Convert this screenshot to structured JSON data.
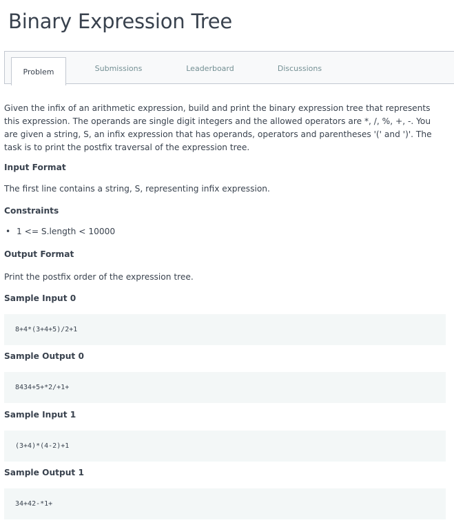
{
  "page": {
    "title": "Binary Expression Tree"
  },
  "tabs": [
    {
      "label": "Problem",
      "active": true
    },
    {
      "label": "Submissions",
      "active": false
    },
    {
      "label": "Leaderboard",
      "active": false
    },
    {
      "label": "Discussions",
      "active": false
    }
  ],
  "problem": {
    "description": "Given the infix of an arithmetic expression, build and print the binary expression tree that represents this expression. The operands are single digit integers and the allowed operators are *, /, %, +, -. You are given a string, S, an infix expression that has operands, operators and parentheses '(' and ')'. The task is to print the postfix traversal of the expression tree.",
    "input_format_heading": "Input Format",
    "input_format_text": "The first line contains a string, S, representing infix expression.",
    "constraints_heading": "Constraints",
    "constraints": [
      "1 <= S.length < 10000"
    ],
    "output_format_heading": "Output Format",
    "output_format_text": "Print the postfix order of the expression tree.",
    "samples": [
      {
        "heading": "Sample Input 0",
        "code": "8+4*(3+4+5)/2+1"
      },
      {
        "heading": "Sample Output 0",
        "code": "8434+5+*2/+1+"
      },
      {
        "heading": "Sample Input 1",
        "code": "(3+4)*(4-2)+1"
      },
      {
        "heading": "Sample Output 1",
        "code": "34+42-*1+"
      }
    ]
  },
  "colors": {
    "text": "#39424e",
    "muted_tab": "#738f93",
    "border": "#c2c7d0",
    "code_bg": "#f3f7f7"
  }
}
